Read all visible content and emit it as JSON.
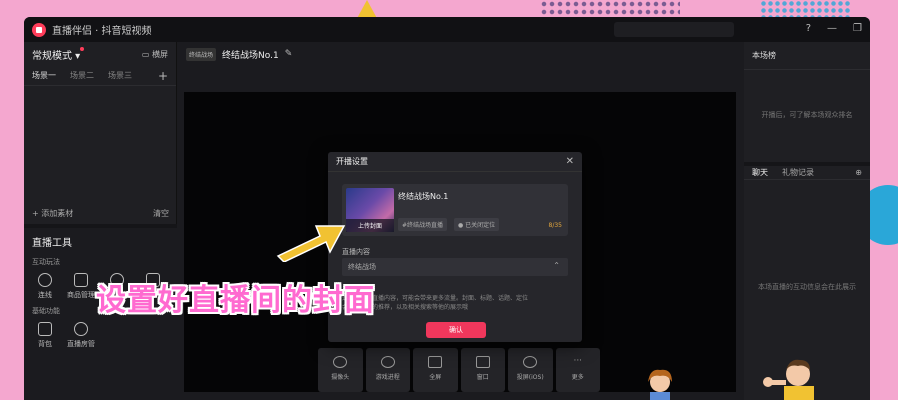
{
  "app": {
    "title": "直播伴侣 · 抖音短视频",
    "window_icons": [
      "help-icon",
      "minimize-icon",
      "maximize-icon"
    ]
  },
  "left_panel": {
    "mode_label": "常规模式",
    "landscape_label": "横屏",
    "scenes": [
      "场景一",
      "场景二",
      "场景三"
    ],
    "add_material": "+ 添加素材",
    "clear": "清空",
    "tools_title": "直播工具",
    "interactive_label": "互动玩法",
    "interactive_tools": [
      "连线",
      "商品管理",
      "",
      ""
    ],
    "basic_label": "基础功能",
    "basic_tools": [
      "背包",
      "直播房管"
    ]
  },
  "center": {
    "mini_thumb": "终结战场",
    "title": "终结战场No.1"
  },
  "right_panel": {
    "scene_header": "本场榜",
    "scene_empty": "开播后，可了解本场观众排名",
    "chat_tabs": [
      "聊天",
      "礼物记录"
    ],
    "chat_empty": "本场直播的互动信息会在此展示"
  },
  "modal": {
    "title": "开播设置",
    "cover_label": "上传封面",
    "live_title": "终结战场No.1",
    "tag": "#终结战场直播",
    "location": "已关闭定位",
    "count": "8/35",
    "content_label": "直播内容",
    "content_value": "终结战场",
    "hint_line1": "选择正确的直播内容，可能会带来更多流量。封面、标题、话题、定位",
    "hint_line2": "会影响粉丝的推荐，以及相关搜索等他的展示哦",
    "confirm": "确认"
  },
  "bottom_bar": [
    "摄像头",
    "游戏进程",
    "全屏",
    "窗口",
    "投屏(iOS)",
    "更多"
  ],
  "overlay": {
    "caption": "设置好直播间的封面"
  },
  "colors": {
    "accent": "#f0375c",
    "background": "#f4a7cf",
    "caption": "#ff6ad0",
    "arrow": "#f1c232"
  }
}
